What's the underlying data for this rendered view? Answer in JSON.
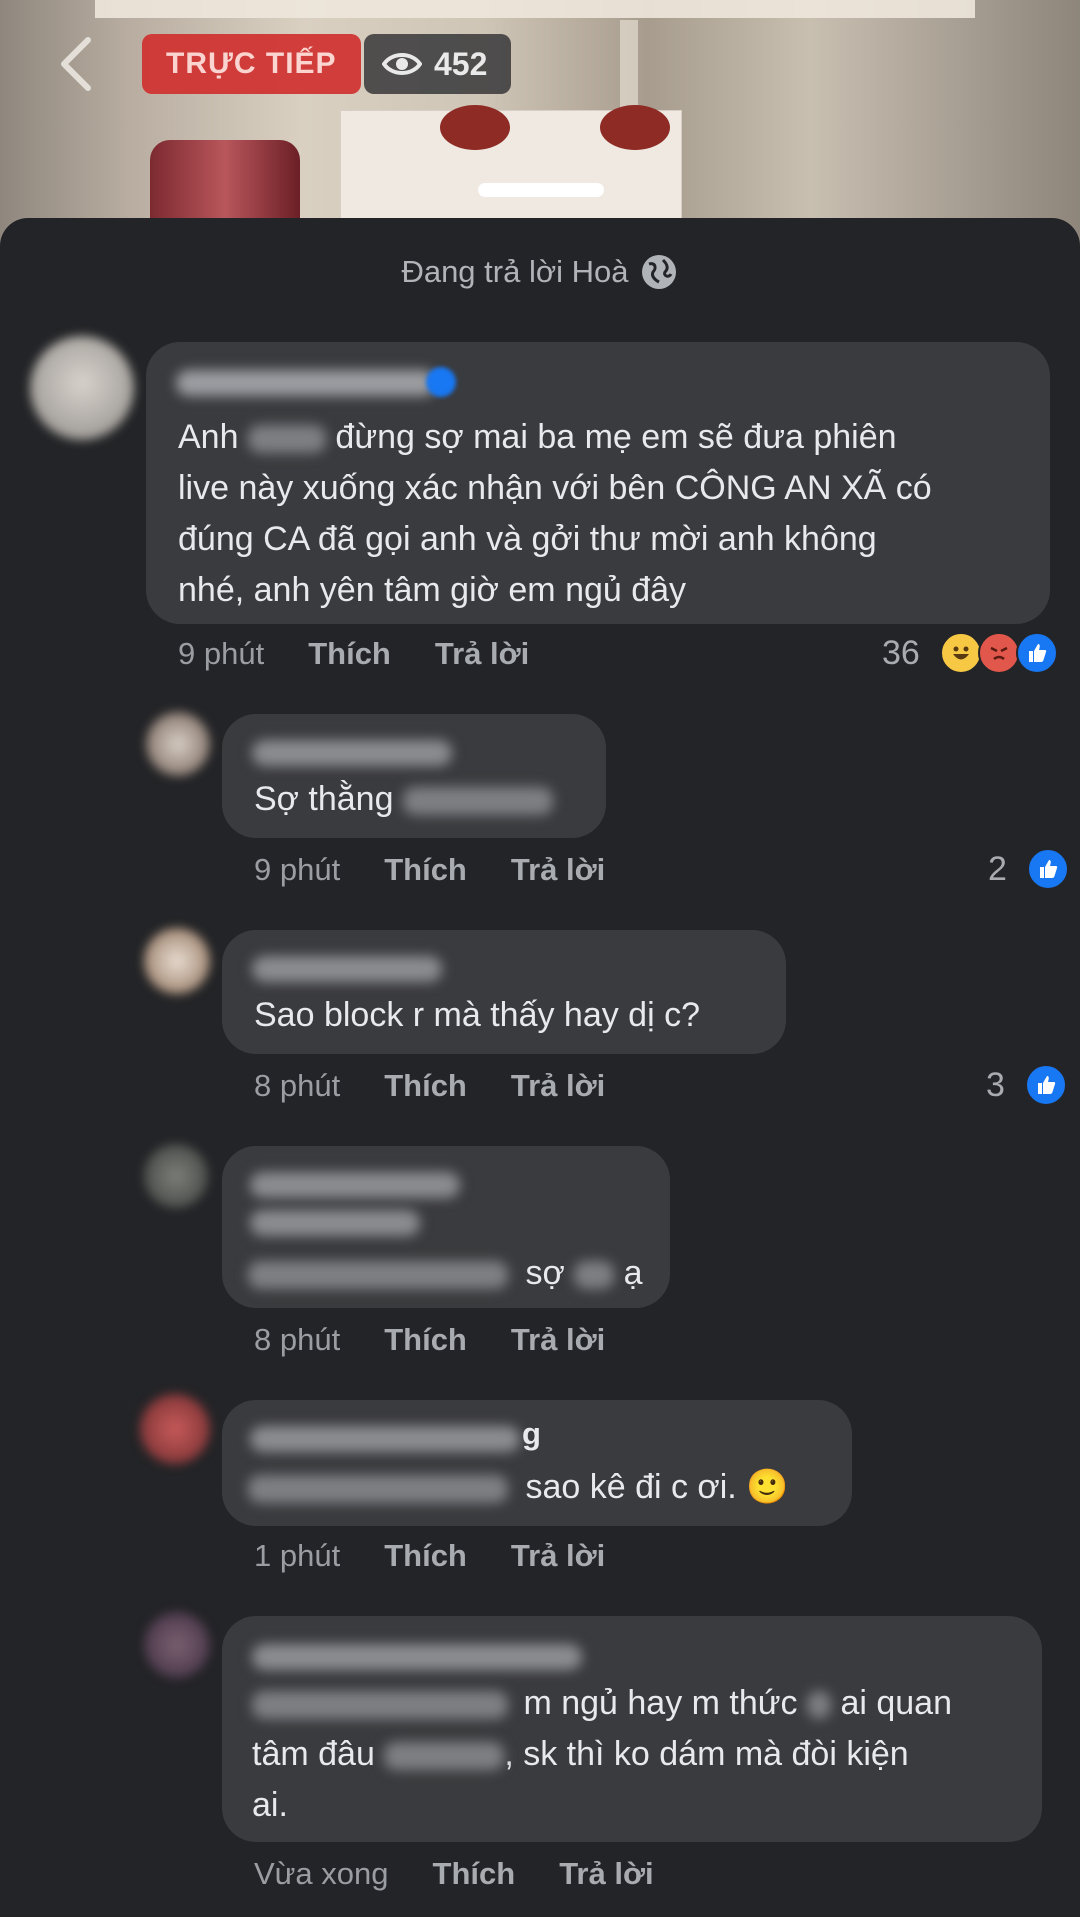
{
  "header": {
    "live_label": "TRỰC TIẾP",
    "viewer_count": "452",
    "replying_to": "Đang trả lời Hoà"
  },
  "colors": {
    "accent_like": "#1877f2",
    "live_badge": "#d0312f",
    "bubble": "#3a3b3e",
    "sheet": "#232427"
  },
  "actions": {
    "like": "Thích",
    "reply": "Trả lời"
  },
  "comments": [
    {
      "text_lines": [
        "Anh",
        "đừng sợ mai ba mẹ em sẽ đưa phiên",
        "live này xuống xác nhận với bên CÔNG AN XÃ có",
        "đúng CA đã gọi anh và gởi thư mời anh không",
        "nhé, anh yên tâm giờ em ngủ đây"
      ],
      "time": "9 phút",
      "reaction_count": "36",
      "reaction_icons": [
        "haha-icon",
        "angry-icon",
        "like-icon"
      ]
    },
    {
      "text": "Sợ thằng",
      "time": "9 phút",
      "reaction_count": "2",
      "reaction_icons": [
        "like-icon"
      ]
    },
    {
      "text": "Sao block r mà thấy hay dị c?",
      "time": "8 phút",
      "reaction_count": "3",
      "reaction_icons": [
        "like-icon"
      ]
    },
    {
      "text_before": "sợ",
      "text_after": "ạ",
      "time": "8 phút"
    },
    {
      "name_fragment": "g",
      "text": "sao kê đi c ơi. 🙂",
      "time": "1 phút"
    },
    {
      "line1_a": "m ngủ hay m thức",
      "line1_b": "ai quan",
      "line2_a": "tâm đâu",
      "line2_b": ", sk thì ko dám mà đòi kiện",
      "line3": "ai.",
      "time": "Vừa xong"
    }
  ]
}
